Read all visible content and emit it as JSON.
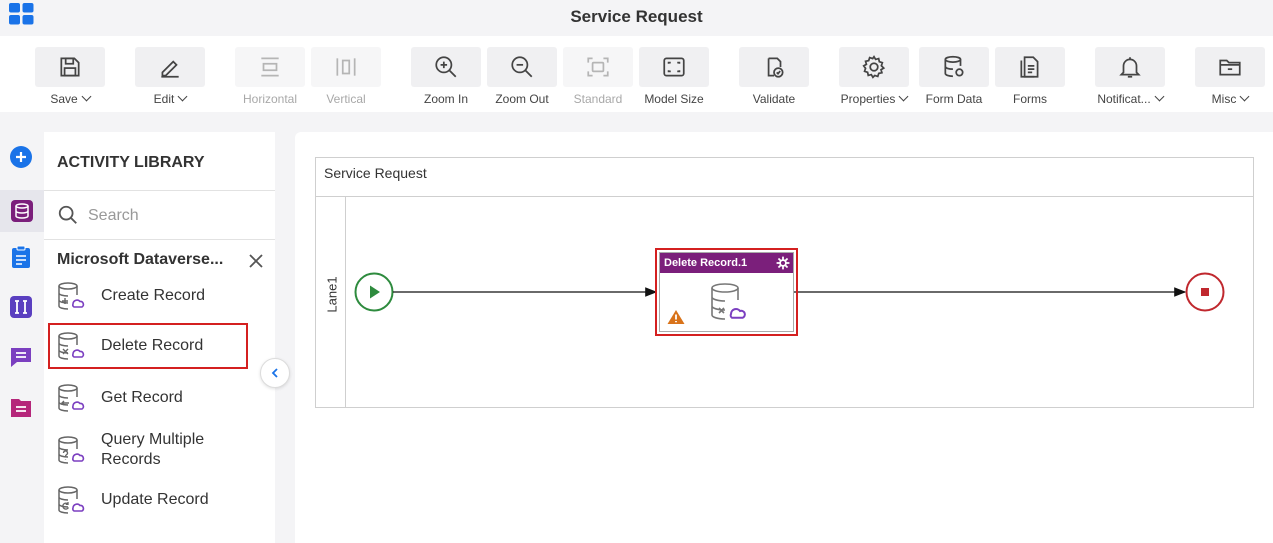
{
  "window": {
    "title": "Service Request"
  },
  "toolbar": {
    "save": "Save",
    "edit": "Edit",
    "horizontal": "Horizontal",
    "vertical": "Vertical",
    "zoom_in": "Zoom In",
    "zoom_out": "Zoom Out",
    "standard": "Standard",
    "model_size": "Model Size",
    "validate": "Validate",
    "properties": "Properties",
    "form_data": "Form Data",
    "forms": "Forms",
    "notifications": "Notificat...",
    "misc": "Misc"
  },
  "library": {
    "title": "ACTIVITY LIBRARY",
    "search_placeholder": "Search",
    "group": "Microsoft Dataverse...",
    "items": [
      {
        "label": "Create Record"
      },
      {
        "label": "Delete Record"
      },
      {
        "label": "Get Record"
      },
      {
        "label": "Query Multiple Records"
      },
      {
        "label": "Update Record"
      }
    ]
  },
  "canvas": {
    "pool_title": "Service Request",
    "lane_title": "Lane1",
    "activity_title": "Delete Record.1"
  },
  "colors": {
    "accent": "#7b1f7b",
    "selection": "#d42020",
    "start": "#2e8b3e",
    "end": "#c0282e",
    "warning": "#d9731a"
  }
}
